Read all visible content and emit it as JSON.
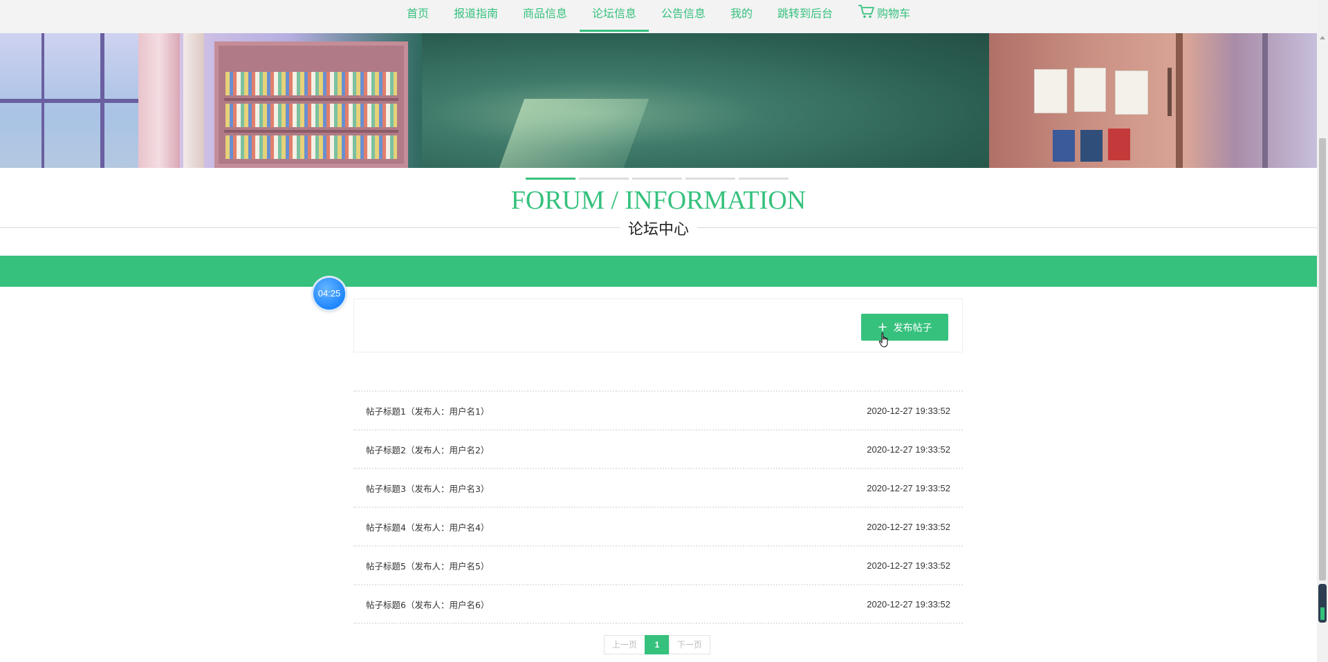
{
  "nav": {
    "items": [
      {
        "label": "首页",
        "active": false
      },
      {
        "label": "报道指南",
        "active": false
      },
      {
        "label": "商品信息",
        "active": false
      },
      {
        "label": "论坛信息",
        "active": true
      },
      {
        "label": "公告信息",
        "active": false
      },
      {
        "label": "我的",
        "active": false
      },
      {
        "label": "跳转到后台",
        "active": false
      }
    ],
    "cart_label": "购物车",
    "cart_icon": "shopping-cart-icon"
  },
  "section": {
    "title": "FORUM / INFORMATION",
    "subtitle": "论坛中心",
    "slide_count": 5,
    "active_slide": 1
  },
  "clock": {
    "time": "04:25"
  },
  "toolbar": {
    "publish_label": "发布帖子",
    "publish_icon": "plus-icon"
  },
  "posts": [
    {
      "title": "帖子标题1（发布人：用户名1）",
      "date": "2020-12-27 19:33:52"
    },
    {
      "title": "帖子标题2（发布人：用户名2）",
      "date": "2020-12-27 19:33:52"
    },
    {
      "title": "帖子标题3（发布人：用户名3）",
      "date": "2020-12-27 19:33:52"
    },
    {
      "title": "帖子标题4（发布人：用户名4）",
      "date": "2020-12-27 19:33:52"
    },
    {
      "title": "帖子标题5（发布人：用户名5）",
      "date": "2020-12-27 19:33:52"
    },
    {
      "title": "帖子标题6（发布人：用户名6）",
      "date": "2020-12-27 19:33:52"
    }
  ],
  "pagination": {
    "prev": "上一页",
    "current": "1",
    "next": "下一页"
  },
  "colors": {
    "accent": "#36c17d",
    "clock": "#1e86ff"
  }
}
